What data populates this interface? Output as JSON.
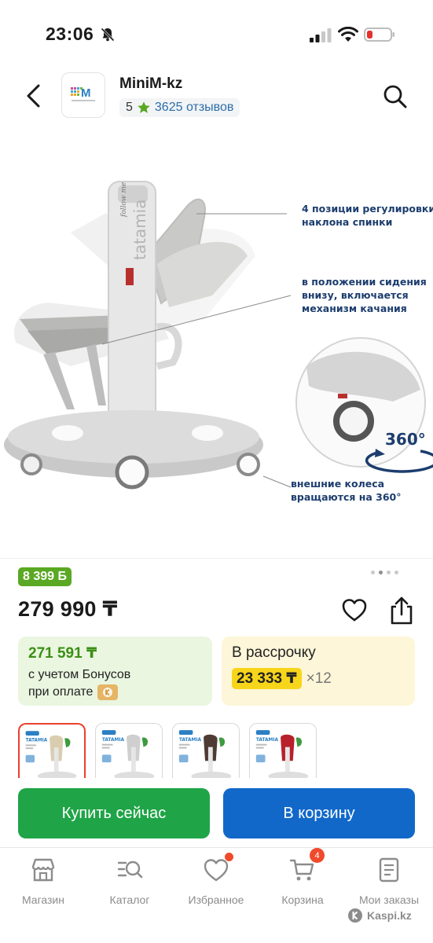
{
  "status_bar": {
    "time": "23:06"
  },
  "shop": {
    "name": "MiniM-kz",
    "rating": "5",
    "reviews": "3625 отзывов"
  },
  "image_annotations": {
    "note1": [
      "4 позиции регулировки",
      "наклона спинки"
    ],
    "note2": [
      "в положении сидения",
      "внизу, включается",
      "механизм качания"
    ],
    "note3": [
      "внешние колеса",
      "вращаются на 360°"
    ],
    "badge_360": "360°",
    "brand_text": "tatamia",
    "brand_tag": "follow me"
  },
  "pager": {
    "count": 4,
    "active": 1
  },
  "product": {
    "bonus_badge": "8 399 Б",
    "price": "279 990 ₸"
  },
  "bonus_card": {
    "amount": "271 591 ₸",
    "line1": "с учетом Бонусов",
    "line2": "при оплате"
  },
  "installment_card": {
    "title": "В рассрочку",
    "amount": "23 333 ₸",
    "months": "×12"
  },
  "thumbnails": [
    {
      "title": "TATAMIA",
      "color": "#d9cdb0",
      "selected": true
    },
    {
      "title": "TATAMIA",
      "color": "#cfcfcf",
      "selected": false
    },
    {
      "title": "TATAMIA",
      "color": "#4e3b33",
      "selected": false
    },
    {
      "title": "TATAMIA",
      "color": "#b8202b",
      "selected": false
    }
  ],
  "actions": {
    "buy_now": "Купить сейчас",
    "add_to_cart": "В корзину"
  },
  "tabbar": {
    "shop": "Магазин",
    "catalog": "Каталог",
    "favorites": "Избранное",
    "cart": "Корзина",
    "cart_count": "4",
    "orders": "Мои заказы"
  },
  "footer": {
    "brand": "Kaspi.kz"
  },
  "colors": {
    "bonus_green": "#5aa823",
    "buy_green": "#1fa447",
    "cart_blue": "#1168c9",
    "installment_yellow": "#f7d51b",
    "badge_red": "#f04a2c"
  }
}
